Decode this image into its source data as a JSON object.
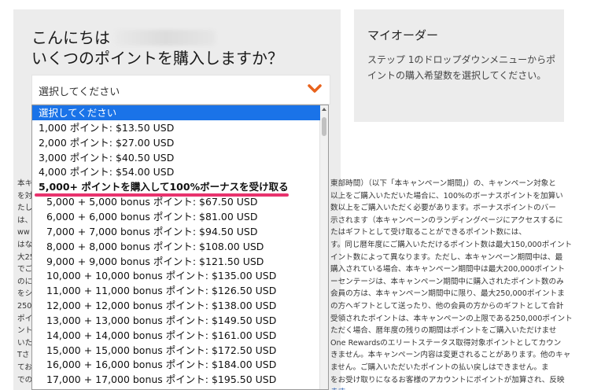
{
  "greeting": {
    "hello": "こんにちは",
    "question": "いくつのポイントを購入しますか？"
  },
  "select": {
    "placeholder": "選択してください",
    "chevron_icon": "chevron-down-icon",
    "accent_color": "#e8621c"
  },
  "order_panel": {
    "title": "マイオーダー",
    "description": "ステップ 1のドロップダウンメニューからポイントの購入希望数を選択してください。"
  },
  "dropdown": {
    "selected_color": "#1a73e8",
    "options": [
      "選択してください",
      "1,000 ポイント: $13.50 USD",
      "2,000 ポイント: $27.00 USD",
      "3,000 ポイント: $40.50 USD",
      "4,000 ポイント: $54.00 USD",
      "5,000+ ポイントを購入して100%ボーナスを受け取る",
      "5,000 + 5,000 bonus ポイント: $67.50 USD",
      "6,000 + 6,000 bonus ポイント: $81.00 USD",
      "7,000 + 7,000 bonus ポイント: $94.50 USD",
      "8,000 + 8,000 bonus ポイント: $108.00 USD",
      "9,000 + 9,000 bonus ポイント: $121.50 USD",
      "10,000 + 10,000 bonus ポイント: $135.00 USD",
      "11,000 + 11,000 bonus ポイント: $126.50 USD",
      "12,000 + 12,000 bonus ポイント: $138.00 USD",
      "13,000 + 13,000 bonus ポイント: $149.50 USD",
      "14,000 + 14,000 bonus ポイント: $161.00 USD",
      "15,000 + 15,000 bonus ポイント: $172.50 USD",
      "16,000 + 16,000 bonus ポイント: $184.00 USD",
      "17,000 + 17,000 bonus ポイント: $195.50 USD"
    ]
  },
  "terms": {
    "left_fragments": [
      "本キ",
      "を対",
      "たし",
      "は、",
      "ww",
      "はな",
      "大25",
      "でご",
      "のに",
      "をシ",
      "250",
      "ポイ",
      "ント",
      "いた",
      "Tさ",
      "てお",
      "での"
    ],
    "right_lines": [
      "東部時間）（以下「本キャンペーン期間」）の、キャンペーン対象と",
      "以上をご購入いただいた場合に、100%のボーナスポイントを加算い",
      "数以上をご購入いただく必要があります。ボーナスポイントのバー",
      "示されます（本キャンペーンのランディングページにアクセスするに",
      "たはギフトとして受け取ることができるポイント数には、",
      "す。同じ暦年度にご購入いただけるポイント数は最大150,000ポイント",
      "イント数によって異なります。ただし、本キャンペーン期間中は、最",
      "購入されている場合、本キャンペーン期間中は最大200,000ポイント",
      "ーセンテージは、本キャンペーン期間中に購入されたポイント数のみ",
      "会員の方は、本キャンペーン期間中に限り、最大250,000ポイントま",
      "の方へギフトとして送ったり、他の会員の方からのギフトとして合計",
      "受領されたポイントは、本キャンペーンの上限である250,000ポイント",
      "ただく場合、暦年度の残りの期間はポイントをご購入いただけませ",
      "One Rewardsのエリートステータス取得対象ポイントとしてカウン",
      "きません。本キャンペーン内容は変更されることがあります。他のキャ",
      "ません。ご購入いただいたポイントの払い戻しはできません。ま",
      "をお受け取りになるお客様のアカウントにポイントが加算され、反映",
      "ます"
    ]
  }
}
